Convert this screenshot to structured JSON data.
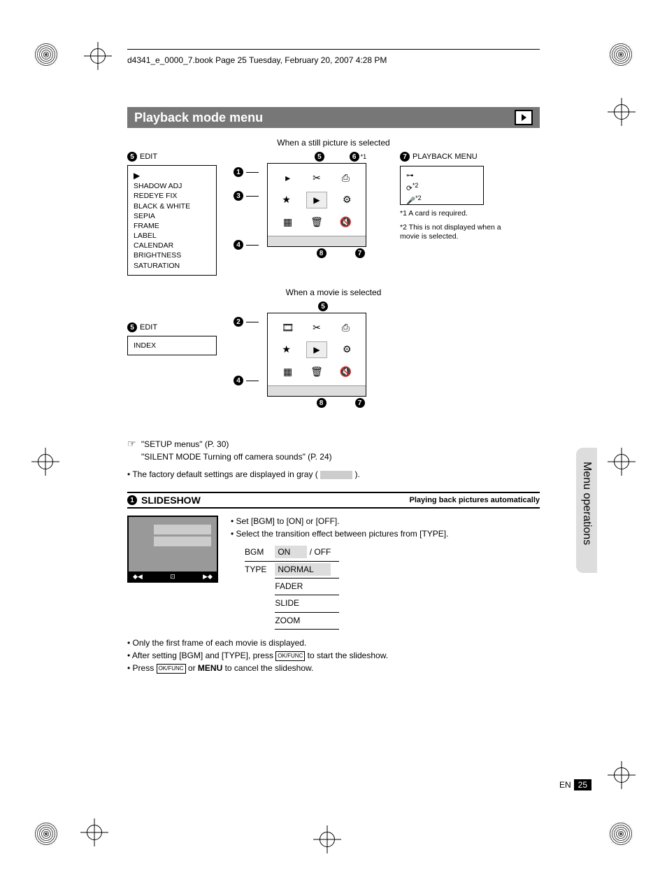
{
  "header_line": "d4341_e_0000_7.book  Page 25  Tuesday, February 20, 2007  4:28 PM",
  "section_title": "Playback mode menu",
  "caption_still": "When a still picture is selected",
  "caption_movie": "When a movie is selected",
  "edit_label": "EDIT",
  "edit_num": "5",
  "edit_items_still": [
    "SHADOW ADJ",
    "REDEYE FIX",
    "BLACK & WHITE",
    "SEPIA",
    "FRAME",
    "LABEL",
    "CALENDAR",
    "BRIGHTNESS",
    "SATURATION"
  ],
  "edit_items_movie": [
    "INDEX"
  ],
  "playback_menu_label": "PLAYBACK MENU",
  "playback_menu_num": "7",
  "playback_menu_sup": [
    "*2",
    "*2"
  ],
  "footnotes": {
    "f1": "*1 A card is required.",
    "f2": "*2 This is not displayed when a movie is selected."
  },
  "top_callouts_still": [
    "5",
    "6"
  ],
  "top_sup_still": "*1",
  "side_callouts_still": [
    "1",
    "3",
    "4"
  ],
  "bottom_callouts_still": [
    "8",
    "7"
  ],
  "top_callouts_movie": [
    "5"
  ],
  "side_callouts_movie": [
    "2",
    "4"
  ],
  "bottom_callouts_movie": [
    "8",
    "7"
  ],
  "crossref1": "\"SETUP menus\" (P. 30)",
  "crossref2": "\"SILENT MODE Turning off camera sounds\" (P. 24)",
  "factory_note_pre": "The factory default settings are displayed in gray (",
  "factory_note_post": ").",
  "sub_num": "1",
  "sub_title": "SLIDESHOW",
  "sub_right": "Playing back pictures automatically",
  "bullets_top": [
    "Set [BGM] to [ON] or [OFF].",
    "Select the transition effect between pictures from [TYPE]."
  ],
  "table": {
    "rows": [
      {
        "label": "BGM",
        "shaded": "ON",
        "rest": "/ OFF"
      },
      {
        "label": "TYPE",
        "shaded": "NORMAL",
        "rest": ""
      }
    ],
    "extra": [
      "FADER",
      "SLIDE",
      "ZOOM"
    ]
  },
  "notes": {
    "n1": "Only the first frame of each movie is displayed.",
    "n2_pre": "After setting [BGM] and [TYPE], press ",
    "n2_post": " to start the slideshow.",
    "n3_pre": "Press ",
    "n3_mid": " or ",
    "n3_menu": "MENU",
    "n3_post": " to cancel the slideshow."
  },
  "okfunc": "OK/FUNC",
  "side_tab": "Menu operations",
  "page_lang": "EN",
  "page_num": "25"
}
